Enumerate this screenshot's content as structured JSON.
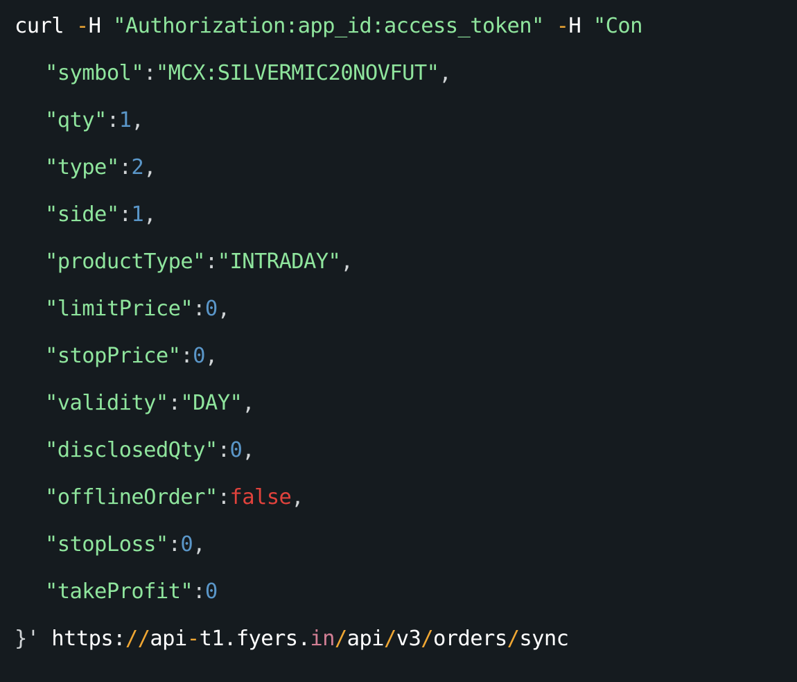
{
  "colors": {
    "background": "#151b1f",
    "string": "#8fe59d",
    "number": "#5a96c8",
    "boolean": "#e0423c",
    "flag": "#f0a733",
    "plain": "#ffffff"
  },
  "code": {
    "command": "curl",
    "flag1_dash": "-",
    "flag1_name": "H",
    "header1": "\"Authorization:app_id:access_token\"",
    "flag2_dash": "-",
    "flag2_name": "H",
    "header2_partial": "\"Con",
    "fields": [
      {
        "key": "\"symbol\"",
        "value": "\"MCX:SILVERMIC20NOVFUT\"",
        "value_type": "string",
        "comma": ","
      },
      {
        "key": "\"qty\"",
        "value": "1",
        "value_type": "number",
        "comma": ","
      },
      {
        "key": "\"type\"",
        "value": "2",
        "value_type": "number",
        "comma": ","
      },
      {
        "key": "\"side\"",
        "value": "1",
        "value_type": "number",
        "comma": ","
      },
      {
        "key": "\"productType\"",
        "value": "\"INTRADAY\"",
        "value_type": "string",
        "comma": ","
      },
      {
        "key": "\"limitPrice\"",
        "value": "0",
        "value_type": "number",
        "comma": ","
      },
      {
        "key": "\"stopPrice\"",
        "value": "0",
        "value_type": "number",
        "comma": ","
      },
      {
        "key": "\"validity\"",
        "value": "\"DAY\"",
        "value_type": "string",
        "comma": ","
      },
      {
        "key": "\"disclosedQty\"",
        "value": "0",
        "value_type": "number",
        "comma": ","
      },
      {
        "key": "\"offlineOrder\"",
        "value": "false",
        "value_type": "boolean",
        "comma": ","
      },
      {
        "key": "\"stopLoss\"",
        "value": "0",
        "value_type": "number",
        "comma": ","
      },
      {
        "key": "\"takeProfit\"",
        "value": "0",
        "value_type": "number",
        "comma": ""
      }
    ],
    "colon": ":",
    "closing": "}'",
    "url_parts": [
      {
        "text": "https:",
        "role": "plain"
      },
      {
        "text": "//",
        "role": "slash"
      },
      {
        "text": "api",
        "role": "plain"
      },
      {
        "text": "-",
        "role": "slash"
      },
      {
        "text": "t1.fyers.",
        "role": "plain"
      },
      {
        "text": "in",
        "role": "in"
      },
      {
        "text": "/",
        "role": "slash"
      },
      {
        "text": "api",
        "role": "plain"
      },
      {
        "text": "/",
        "role": "slash"
      },
      {
        "text": "v3",
        "role": "plain"
      },
      {
        "text": "/",
        "role": "slash"
      },
      {
        "text": "orders",
        "role": "plain"
      },
      {
        "text": "/",
        "role": "slash"
      },
      {
        "text": "sync",
        "role": "plain"
      }
    ]
  }
}
